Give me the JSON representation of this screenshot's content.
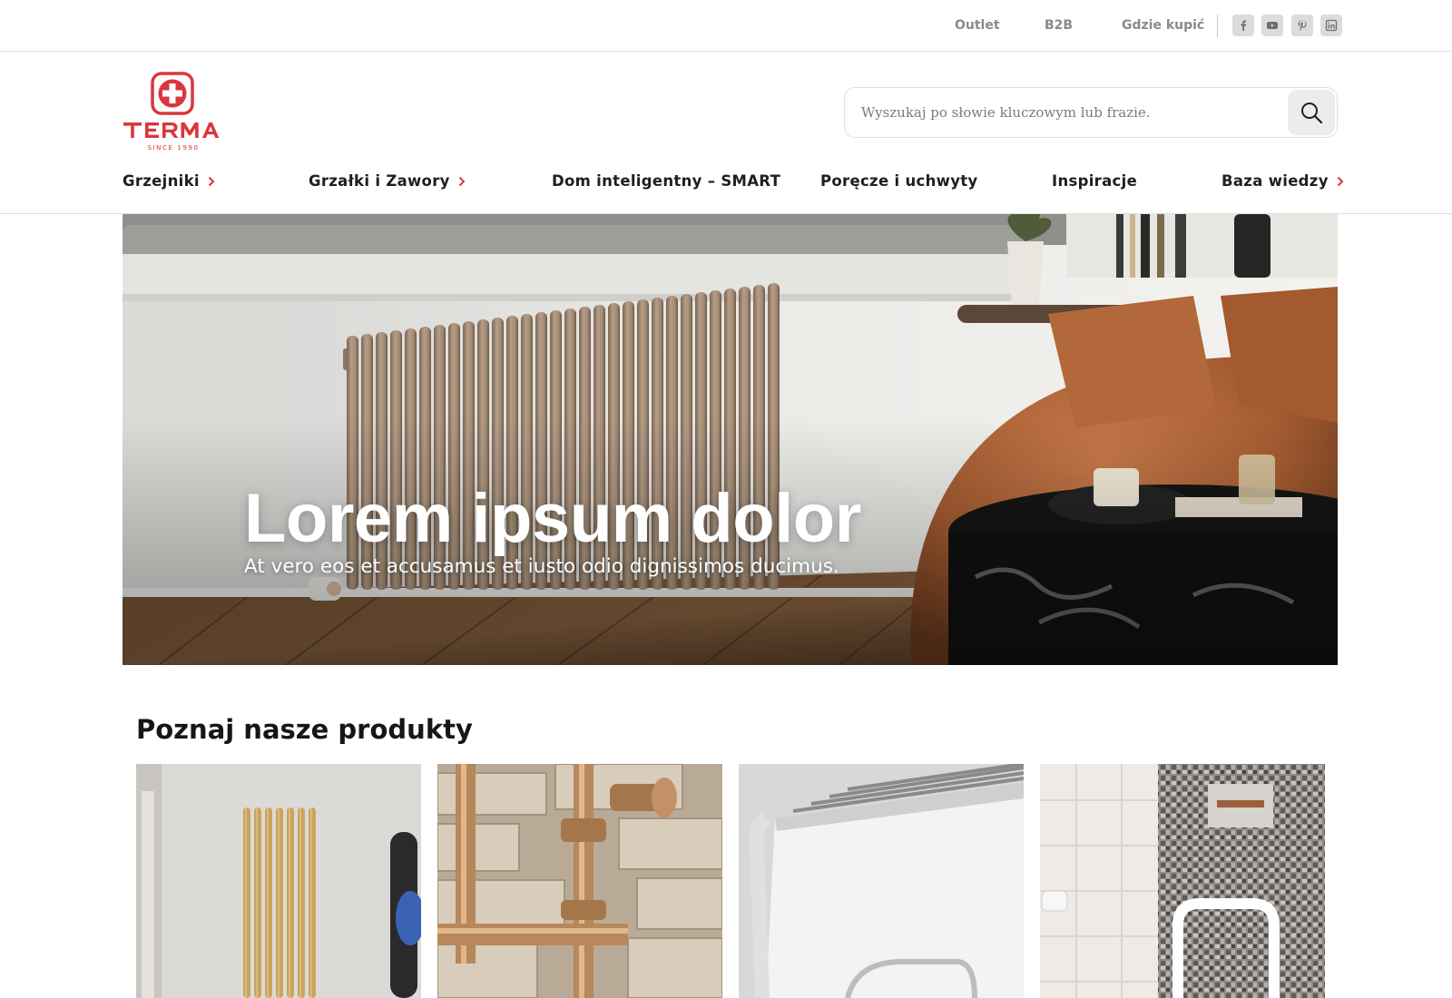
{
  "topbar": {
    "links": [
      "Outlet",
      "B2B",
      "Gdzie kupić"
    ],
    "social_icons": [
      "facebook-icon",
      "youtube-icon",
      "pinterest-icon",
      "linkedin-icon"
    ]
  },
  "brand": {
    "name": "TERMA",
    "tagline": "SINCE 1990",
    "color": "#d9363e"
  },
  "search": {
    "placeholder": "Wyszukaj po słowie kluczowym lub frazie.",
    "value": "",
    "icon": "search-icon"
  },
  "nav": {
    "items": [
      {
        "label": "Grzejniki",
        "has_submenu": true
      },
      {
        "label": "Grzałki i Zawory",
        "has_submenu": true
      },
      {
        "label": "Dom inteligentny – SMART",
        "has_submenu": false
      },
      {
        "label": "Poręcze i uchwyty",
        "has_submenu": false
      },
      {
        "label": "Inspiracje",
        "has_submenu": false
      },
      {
        "label": "Baza wiedzy",
        "has_submenu": true
      }
    ],
    "chevron_color": "#d9363e"
  },
  "hero": {
    "title": "Lorem ipsum dolor",
    "subtitle": "At vero eos et accusamus et iusto odio dignissimos ducimus."
  },
  "products": {
    "heading": "Poznaj nasze produkty",
    "cards": [
      "gold-radiator-photo",
      "copper-pipes-photo",
      "white-radiator-photo",
      "grab-bar-photo"
    ]
  }
}
